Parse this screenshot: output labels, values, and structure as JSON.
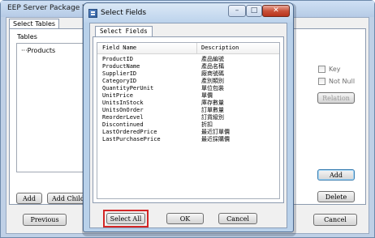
{
  "background_window": {
    "title": "EEP Server Package Wiza",
    "tab_label": "Select Tables",
    "tables_group_label": "Tables",
    "tree_root_label": "···Products",
    "key_checkbox_label": "Key",
    "not_null_checkbox_label": "Not Null",
    "relation_button": "Relation",
    "add_button_right": "Add",
    "delete_button": "Delete",
    "add_button_left": "Add",
    "add_child_button": "Add Child",
    "previous_button": "Previous",
    "cancel_button": "Cancel"
  },
  "dialog": {
    "title": "Select Fields",
    "tab_label": "Select Fields",
    "columns": {
      "field_name": "Field Name",
      "description": "Description"
    },
    "rows": [
      {
        "field": "ProductID",
        "description": "產品編號"
      },
      {
        "field": "ProductName",
        "description": "產品名稱"
      },
      {
        "field": "SupplierID",
        "description": "廠商號碼"
      },
      {
        "field": "CategoryID",
        "description": "產別類別"
      },
      {
        "field": "QuantityPerUnit",
        "description": "單位包裝"
      },
      {
        "field": "UnitPrice",
        "description": "單價"
      },
      {
        "field": "UnitsInStock",
        "description": "庫存數量"
      },
      {
        "field": "UnitsOnOrder",
        "description": "訂單數量"
      },
      {
        "field": "ReorderLevel",
        "description": "訂貨級別"
      },
      {
        "field": "Discontinued",
        "description": "折扣"
      },
      {
        "field": "LastOrderedPrice",
        "description": "最近訂單價"
      },
      {
        "field": "LastPurchasePrice",
        "description": "最近採購價"
      }
    ],
    "select_all_button": "Select All",
    "ok_button": "OK",
    "cancel_button": "Cancel",
    "window_controls": {
      "minimize": "–",
      "maximize": "□",
      "close": "✕"
    },
    "highlight_color": "#d32626"
  }
}
